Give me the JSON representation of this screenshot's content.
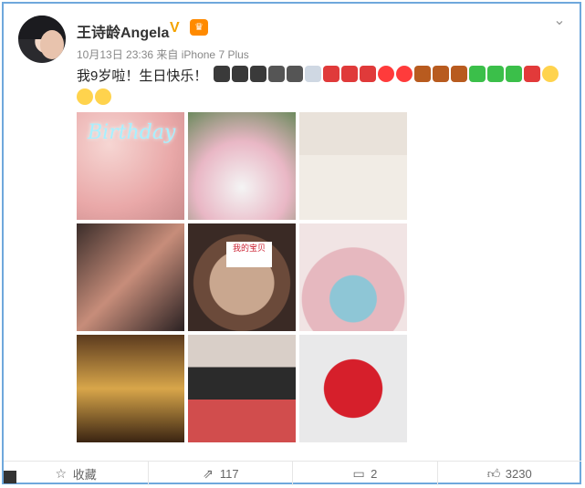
{
  "post": {
    "author": "王诗龄Angela",
    "timestamp": "10月13日 23:36",
    "source": "来自 iPhone 7 Plus",
    "text": "我9岁啦！生日快乐！"
  },
  "icons": {
    "verified": "verified-badge-icon",
    "member": "crown-icon",
    "menu": "chevron-down-icon"
  },
  "emojis": [
    "cake-icon",
    "cake-icon",
    "cake-icon",
    "gift-icon",
    "gift-icon",
    "camera-icon",
    "rose-icon",
    "rose-icon",
    "rose-icon",
    "heart-icon",
    "heart-icon",
    "birthday-cake-icon",
    "birthday-cake-icon",
    "birthday-cake-icon",
    "present-icon",
    "present-icon",
    "present-icon",
    "present-icon",
    "smile-icon"
  ],
  "emojis_row2": [
    "smile-icon",
    "smile-icon"
  ],
  "photos": [
    {
      "overlay": "Birthday"
    },
    {
      "overlay": ""
    },
    {
      "overlay": ""
    },
    {
      "overlay": ""
    },
    {
      "overlay": "我的宝贝"
    },
    {
      "overlay": ""
    },
    {
      "overlay": ""
    },
    {
      "overlay": ""
    },
    {
      "overlay": ""
    }
  ],
  "actions": {
    "favorite_label": "收藏",
    "repost_count": "117",
    "comment_count": "2",
    "like_count": "3230"
  },
  "colors": {
    "frame": "#6fa8dc",
    "name": "#333333",
    "meta": "#888888",
    "verified": "#f4a300"
  }
}
